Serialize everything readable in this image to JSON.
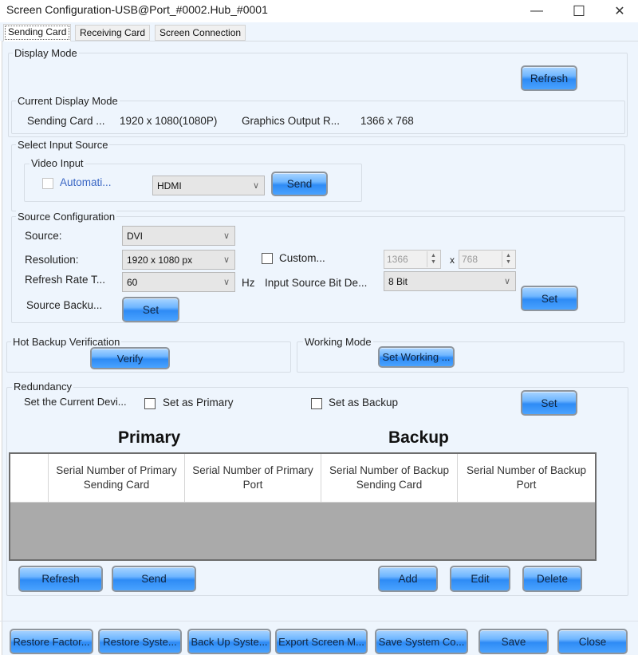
{
  "window": {
    "title": "Screen Configuration-USB@Port_#0002.Hub_#0001",
    "controls": {
      "minimize": "—",
      "maximize": "☐",
      "close": "✕"
    }
  },
  "tabs": [
    {
      "label": "Sending Card",
      "active": true
    },
    {
      "label": "Receiving Card",
      "active": false
    },
    {
      "label": "Screen Connection",
      "active": false
    }
  ],
  "display_mode": {
    "legend": "Display Mode",
    "refresh_label": "Refresh",
    "current": {
      "legend": "Current Display Mode",
      "sending_card_label": "Sending Card ...",
      "sending_card_value": "1920 x 1080(1080P)",
      "graphics_output_label": "Graphics Output R...",
      "graphics_output_value": "1366 x 768"
    }
  },
  "input_source": {
    "legend": "Select Input Source",
    "video_input": {
      "legend": "Video Input",
      "auto_label": "Automati...",
      "auto_checked": false,
      "selected": "HDMI",
      "send_label": "Send"
    }
  },
  "source_config": {
    "legend": "Source Configuration",
    "source_label": "Source:",
    "source_value": "DVI",
    "resolution_label": "Resolution:",
    "resolution_value": "1920 x 1080 px",
    "custom_label": "Custom...",
    "custom_checked": false,
    "custom_width": "1366",
    "custom_x": "x",
    "custom_height": "768",
    "refresh_rate_label": "Refresh Rate T...",
    "refresh_rate_value": "60",
    "hz_label": "Hz",
    "bit_depth_label": "Input Source Bit De...",
    "bit_depth_value": "8 Bit",
    "source_backup_label": "Source Backu...",
    "source_backup_set": "Set",
    "set_label": "Set"
  },
  "hot_backup": {
    "legend": "Hot Backup Verification",
    "verify_label": "Verify"
  },
  "working_mode": {
    "legend": "Working Mode",
    "button_label": "Set Working ..."
  },
  "redundancy": {
    "legend": "Redundancy",
    "current_device_label": "Set the Current Devi...",
    "set_primary_label": "Set as Primary",
    "set_primary_checked": false,
    "set_backup_label": "Set as Backup",
    "set_backup_checked": false,
    "set_label": "Set",
    "primary_heading": "Primary",
    "backup_heading": "Backup",
    "table": {
      "columns": [
        "",
        "Serial Number of Primary Sending Card",
        "Serial Number of Primary Port",
        "Serial Number of Backup Sending Card",
        "Serial Number of Backup Port"
      ],
      "rows": []
    },
    "buttons": {
      "refresh": "Refresh",
      "send": "Send",
      "add": "Add",
      "edit": "Edit",
      "delete": "Delete"
    }
  },
  "footer": {
    "restore_factory": "Restore Factor...",
    "restore_system": "Restore Syste...",
    "back_up_system": "Back Up Syste...",
    "export_screen": "Export Screen M...",
    "save_system": "Save System Co...",
    "save": "Save",
    "close": "Close"
  }
}
